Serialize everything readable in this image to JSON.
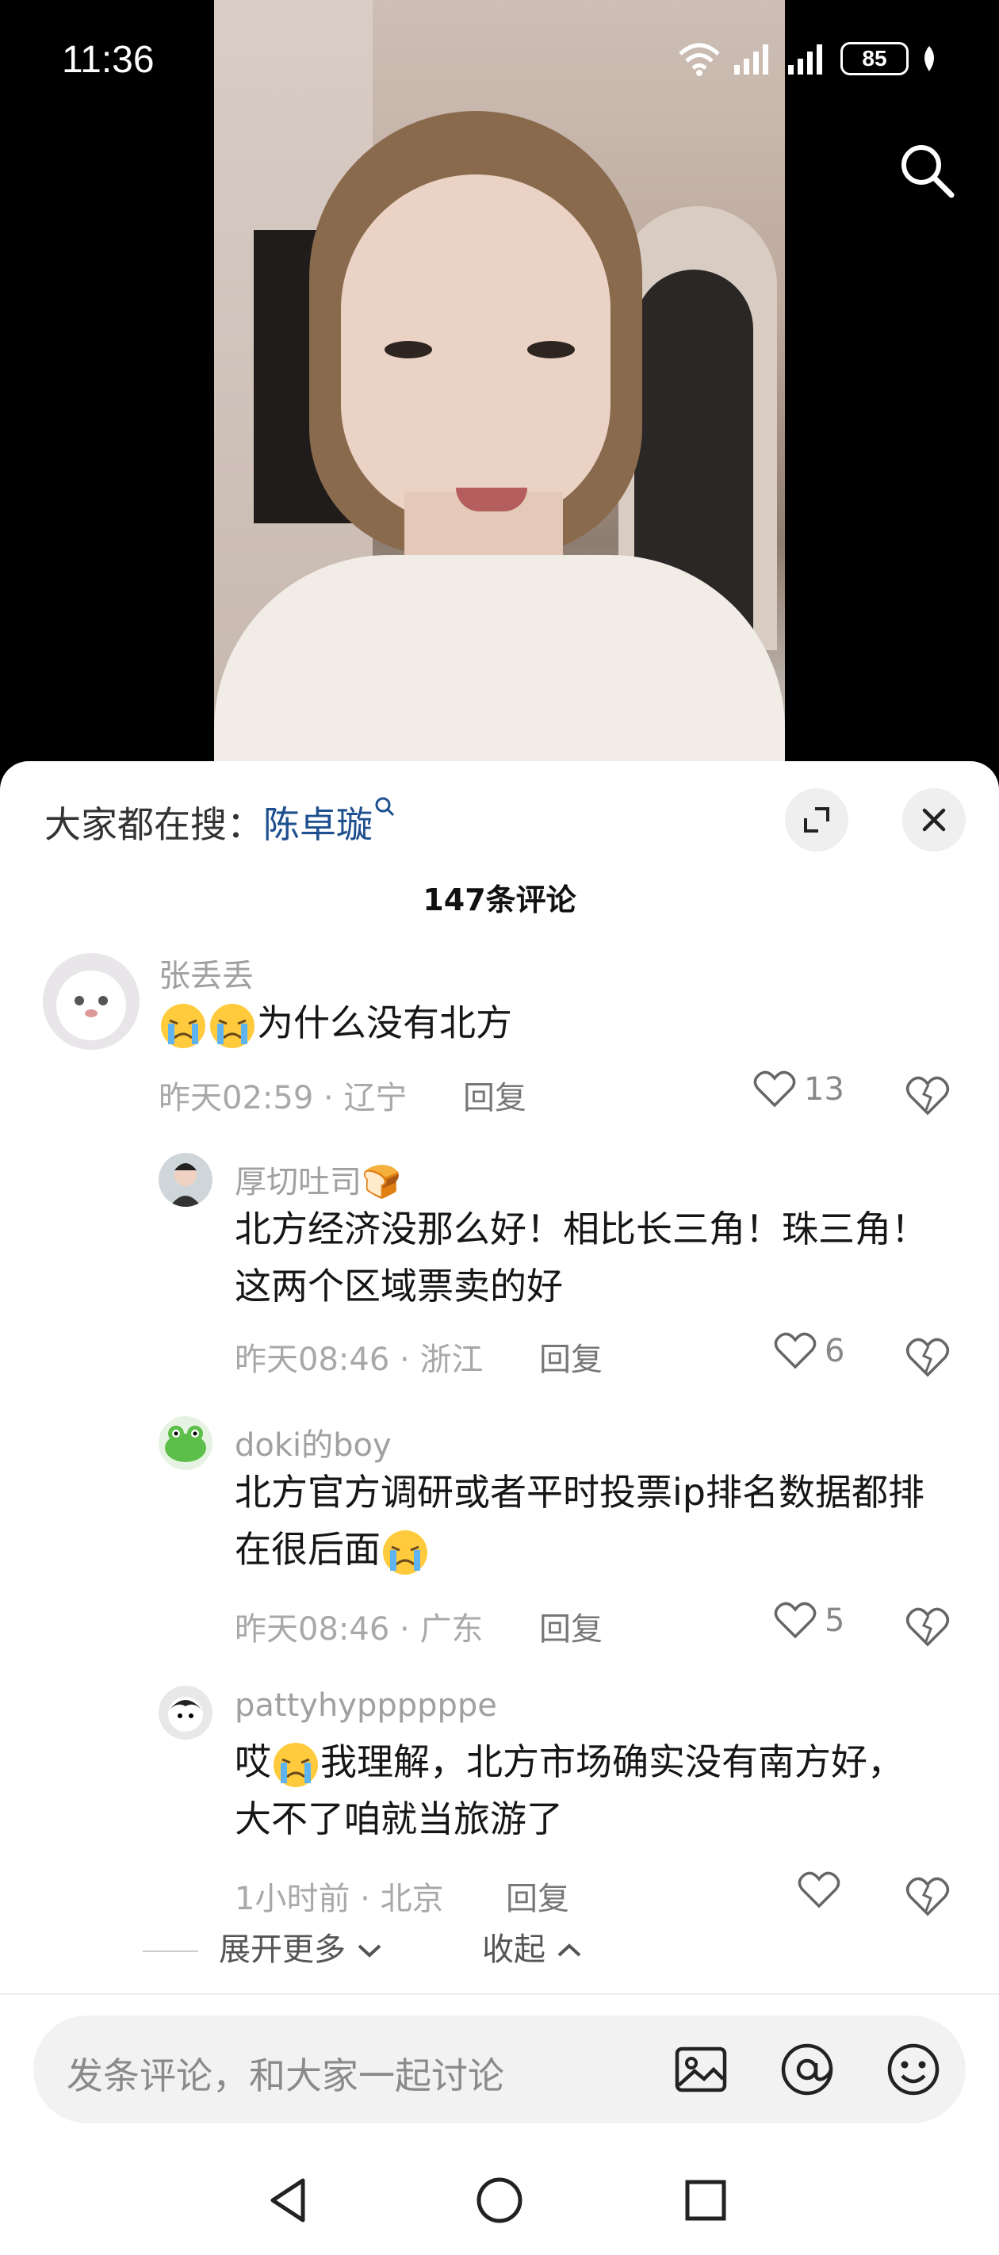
{
  "status_bar": {
    "time": "11:36",
    "battery": "85"
  },
  "sheet": {
    "search_hint_prefix": "大家都在搜：",
    "search_hint_keyword": "陈卓璇",
    "comment_count": "147条评论"
  },
  "comments": [
    {
      "name": "张丢丢",
      "text": "为什么没有北方",
      "time": "昨天02:59",
      "location": "辽宁",
      "reply_label": "回复",
      "likes": "13"
    },
    {
      "name": "厚切吐司🍞",
      "text": "北方经济没那么好！相比长三角！珠三角！这两个区域票卖的好",
      "time": "昨天08:46",
      "location": "浙江",
      "reply_label": "回复",
      "likes": "6"
    },
    {
      "name": "doki的boy",
      "text": "北方官方调研或者平时投票ip排名数据都排在很后面",
      "time": "昨天08:46",
      "location": "广东",
      "reply_label": "回复",
      "likes": "5"
    },
    {
      "name": "pattyhyppppppe",
      "text_prefix": "哎",
      "text": "我理解，北方市场确实没有南方好，大不了咱就当旅游了",
      "time": "1小时前",
      "location": "北京",
      "reply_label": "回复",
      "likes": ""
    }
  ],
  "expand_more_label": "展开更多",
  "collapse_label": "收起",
  "input": {
    "placeholder": "发条评论，和大家一起讨论"
  },
  "icons": [
    "search-icon",
    "expand-icon",
    "close-icon",
    "heart-icon",
    "dislike-heart-icon",
    "image-icon",
    "at-icon",
    "emoji-icon",
    "back-nav-icon",
    "home-nav-icon",
    "recents-nav-icon"
  ]
}
